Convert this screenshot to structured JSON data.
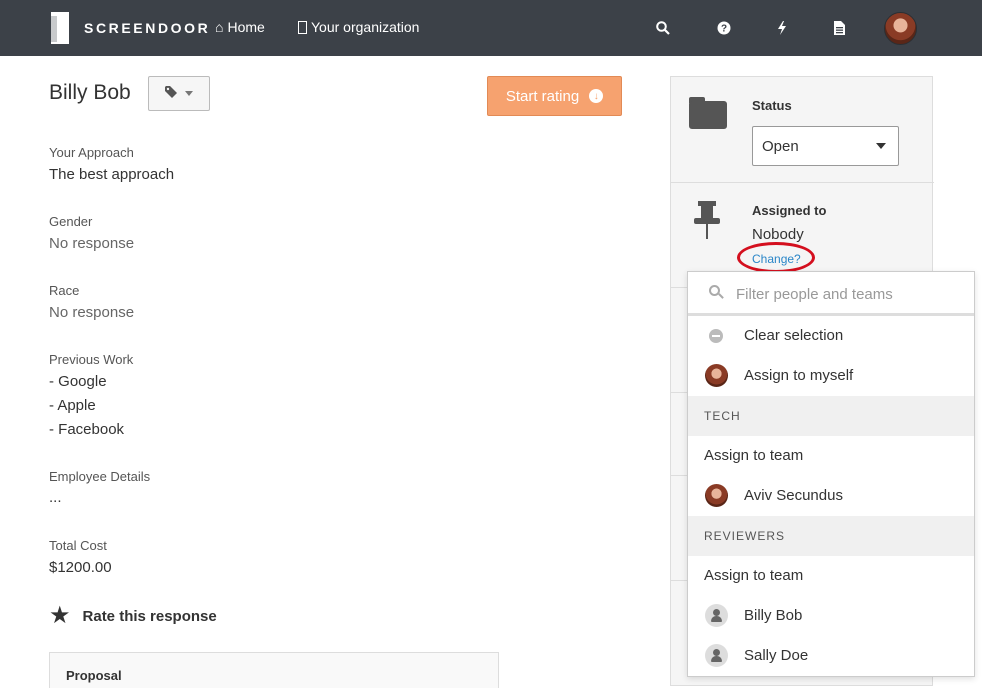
{
  "nav": {
    "brand": "SCREENDOOR",
    "home_label": "Home",
    "org_label": "Your organization",
    "icons": [
      "search-icon",
      "help-icon",
      "bolt-icon",
      "document-icon"
    ]
  },
  "header": {
    "title": "Billy Bob",
    "start_rating_label": "Start rating"
  },
  "fields": [
    {
      "label": "Your Approach",
      "value": "The best approach"
    },
    {
      "label": "Gender",
      "value": "No response"
    },
    {
      "label": "Race",
      "value": "No response"
    },
    {
      "label": "Previous Work",
      "values": [
        "- Google",
        "- Apple",
        "- Facebook"
      ]
    },
    {
      "label": "Employee Details",
      "value": "..."
    },
    {
      "label": "Total Cost",
      "value": "$1200.00"
    }
  ],
  "rate_label": "Rate this response",
  "proposal_label": "Proposal",
  "panel": {
    "status_label": "Status",
    "status_value": "Open",
    "assigned_label": "Assigned to",
    "assigned_value": "Nobody",
    "change_link": "Change?"
  },
  "dropdown": {
    "search_placeholder": "Filter people and teams",
    "clear_label": "Clear selection",
    "assign_self_label": "Assign to myself",
    "groups": [
      {
        "name": "TECH",
        "assign_team_label": "Assign to team",
        "members": [
          "Aviv Secundus"
        ]
      },
      {
        "name": "REVIEWERS",
        "assign_team_label": "Assign to team",
        "members": [
          "Billy Bob",
          "Sally Doe"
        ]
      }
    ]
  },
  "colors": {
    "navbar": "#3c4148",
    "accent": "#f6a26f",
    "link": "#2a86c8",
    "highlight_ring": "#d40f1e"
  }
}
